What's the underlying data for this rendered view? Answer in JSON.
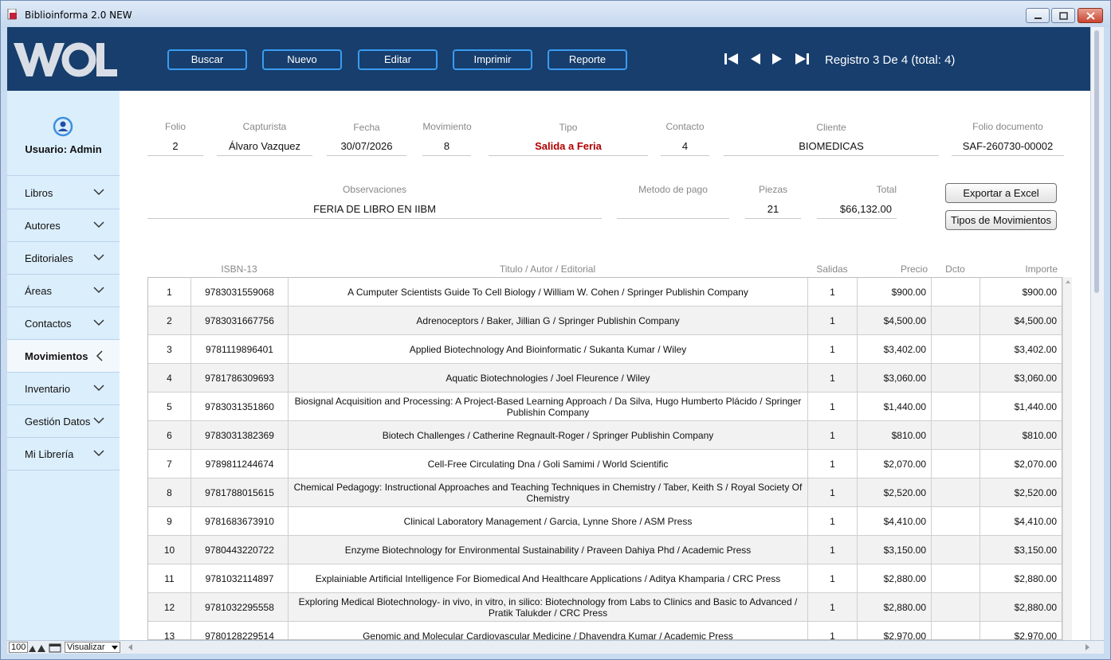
{
  "window": {
    "title": "Biblioinforma 2.0 NEW"
  },
  "toolbar": {
    "buttons": [
      "Buscar",
      "Nuevo",
      "Editar",
      "Imprimir",
      "Reporte"
    ],
    "record_text": "Registro 3 De 4  (total: 4)"
  },
  "sidebar": {
    "user_label": "Usuario: Admin",
    "items": [
      {
        "label": "Libros"
      },
      {
        "label": "Autores"
      },
      {
        "label": "Editoriales"
      },
      {
        "label": "Áreas"
      },
      {
        "label": "Contactos"
      },
      {
        "label": "Movimientos"
      },
      {
        "label": "Inventario"
      },
      {
        "label": "Gestión Datos"
      },
      {
        "label": "Mi Librería"
      }
    ]
  },
  "form": {
    "folio": {
      "label": "Folio",
      "value": "2"
    },
    "capturista": {
      "label": "Capturista",
      "value": "Álvaro Vazquez"
    },
    "fecha": {
      "label": "Fecha",
      "value": "30/07/2026"
    },
    "movimiento": {
      "label": "Movimiento",
      "value": "8"
    },
    "tipo": {
      "label": "Tipo",
      "value": "Salida a Feria"
    },
    "contacto": {
      "label": "Contacto",
      "value": "4"
    },
    "cliente": {
      "label": "Cliente",
      "value": "BIOMEDICAS"
    },
    "folio_documento": {
      "label": "Folio documento",
      "value": "SAF-260730-00002"
    },
    "observaciones": {
      "label": "Observaciones",
      "value": "FERIA DE LIBRO EN IIBM"
    },
    "metodo_pago": {
      "label": "Metodo de pago",
      "value": ""
    },
    "piezas": {
      "label": "Piezas",
      "value": "21"
    },
    "total": {
      "label": "Total",
      "value": "$66,132.00"
    },
    "export_button": "Exportar a Excel",
    "tipos_button": "Tipos de Movimientos"
  },
  "table": {
    "headers": {
      "isbn": "ISBN-13",
      "title": "Titulo / Autor / Editorial",
      "salidas": "Salidas",
      "precio": "Precio",
      "dcto": "Dcto",
      "importe": "Importe"
    },
    "rows": [
      {
        "n": "1",
        "isbn": "9783031559068",
        "title": "A Cumputer Scientists Guide To Cell Biology  /  William W. Cohen  /  Springer Publishin Company",
        "salidas": "1",
        "precio": "$900.00",
        "dcto": "",
        "importe": "$900.00"
      },
      {
        "n": "2",
        "isbn": "9783031667756",
        "title": "Adrenoceptors  /  Baker, Jillian G  /  Springer Publishin Company",
        "salidas": "1",
        "precio": "$4,500.00",
        "dcto": "",
        "importe": "$4,500.00"
      },
      {
        "n": "3",
        "isbn": "9781119896401",
        "title": "Applied Biotechnology And Bioinformatic  /  Sukanta Kumar  /  Wiley",
        "salidas": "1",
        "precio": "$3,402.00",
        "dcto": "",
        "importe": "$3,402.00"
      },
      {
        "n": "4",
        "isbn": "9781786309693",
        "title": "Aquatic Biotechnologies  /  Joel Fleurence  /  Wiley",
        "salidas": "1",
        "precio": "$3,060.00",
        "dcto": "",
        "importe": "$3,060.00"
      },
      {
        "n": "5",
        "isbn": "9783031351860",
        "title": "Biosignal Acquisition and Processing: A Project-Based Learning Approach  /  Da Silva, Hugo Humberto Plácido  /  Springer Publishin Company",
        "salidas": "1",
        "precio": "$1,440.00",
        "dcto": "",
        "importe": "$1,440.00"
      },
      {
        "n": "6",
        "isbn": "9783031382369",
        "title": "Biotech Challenges  /  Catherine Regnault-Roger  /  Springer Publishin Company",
        "salidas": "1",
        "precio": "$810.00",
        "dcto": "",
        "importe": "$810.00"
      },
      {
        "n": "7",
        "isbn": "9789811244674",
        "title": "Cell-Free Circulating Dna  /  Goli Samimi  /  World Scientific",
        "salidas": "1",
        "precio": "$2,070.00",
        "dcto": "",
        "importe": "$2,070.00"
      },
      {
        "n": "8",
        "isbn": "9781788015615",
        "title": "Chemical Pedagogy: Instructional Approaches and Teaching Techniques in Chemistry  /  Taber, Keith S  /  Royal Society Of Chemistry",
        "salidas": "1",
        "precio": "$2,520.00",
        "dcto": "",
        "importe": "$2,520.00"
      },
      {
        "n": "9",
        "isbn": "9781683673910",
        "title": "Clinical Laboratory Management  /  Garcia, Lynne Shore  /  ASM Press",
        "salidas": "1",
        "precio": "$4,410.00",
        "dcto": "",
        "importe": "$4,410.00"
      },
      {
        "n": "10",
        "isbn": "9780443220722",
        "title": "Enzyme Biotechnology for Environmental Sustainability  /  Praveen Dahiya Phd  /  Academic Press",
        "salidas": "1",
        "precio": "$3,150.00",
        "dcto": "",
        "importe": "$3,150.00"
      },
      {
        "n": "11",
        "isbn": "9781032114897",
        "title": "Explainiable Artificial Intelligence For Biomedical And Healthcare Applications  /  Aditya Khamparia  /  CRC Press",
        "salidas": "1",
        "precio": "$2,880.00",
        "dcto": "",
        "importe": "$2,880.00"
      },
      {
        "n": "12",
        "isbn": "9781032295558",
        "title": "Exploring Medical Biotechnology- in vivo, in vitro, in silico: Biotechnology from Labs to Clinics and Basic to Advanced  /  Pratik Talukder  /  CRC Press",
        "salidas": "1",
        "precio": "$2,880.00",
        "dcto": "",
        "importe": "$2,880.00"
      },
      {
        "n": "13",
        "isbn": "9780128229514",
        "title": "Genomic and Molecular Cardiovascular Medicine  /  Dhavendra Kumar  /  Academic Press",
        "salidas": "1",
        "precio": "$2,970.00",
        "dcto": "",
        "importe": "$2,970.00"
      }
    ]
  },
  "statusbar": {
    "zoom": "100",
    "view_label": "Visualizar"
  },
  "colors": {
    "header_bg": "#173e6d",
    "button_border": "#3a9cf0",
    "sidebar_bg": "#dbeefc",
    "tipo_red": "#b00000"
  },
  "icons": [
    "first-record-icon",
    "prev-record-icon",
    "next-record-icon",
    "last-record-icon",
    "user-icon",
    "chevron-down-icon",
    "chevron-left-icon"
  ]
}
